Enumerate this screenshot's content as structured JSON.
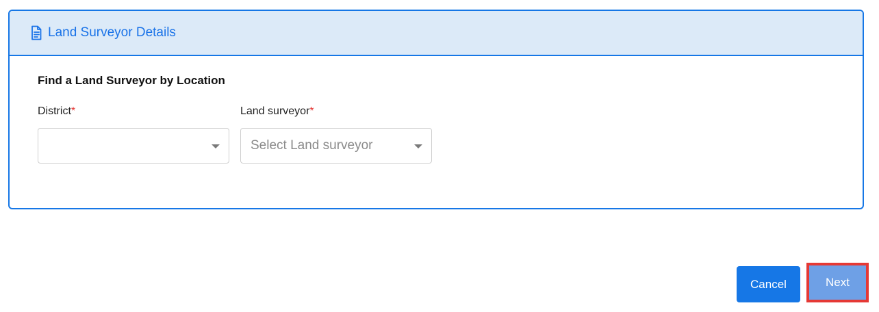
{
  "card": {
    "title": "Land Surveyor Details",
    "header_icon": "document-icon",
    "accent_color": "#1677e6",
    "header_bg": "#dceaf8"
  },
  "form": {
    "section_title": "Find a Land Surveyor by Location",
    "district": {
      "label": "District",
      "required_marker": "*",
      "value": "",
      "placeholder": ""
    },
    "land_surveyor": {
      "label": "Land surveyor",
      "required_marker": "*",
      "value": "",
      "placeholder": "Select Land surveyor"
    }
  },
  "actions": {
    "cancel_label": "Cancel",
    "next_label": "Next",
    "cancel_color": "#1677e6",
    "next_color": "#6ea0e6",
    "highlight_color": "#e53935"
  }
}
